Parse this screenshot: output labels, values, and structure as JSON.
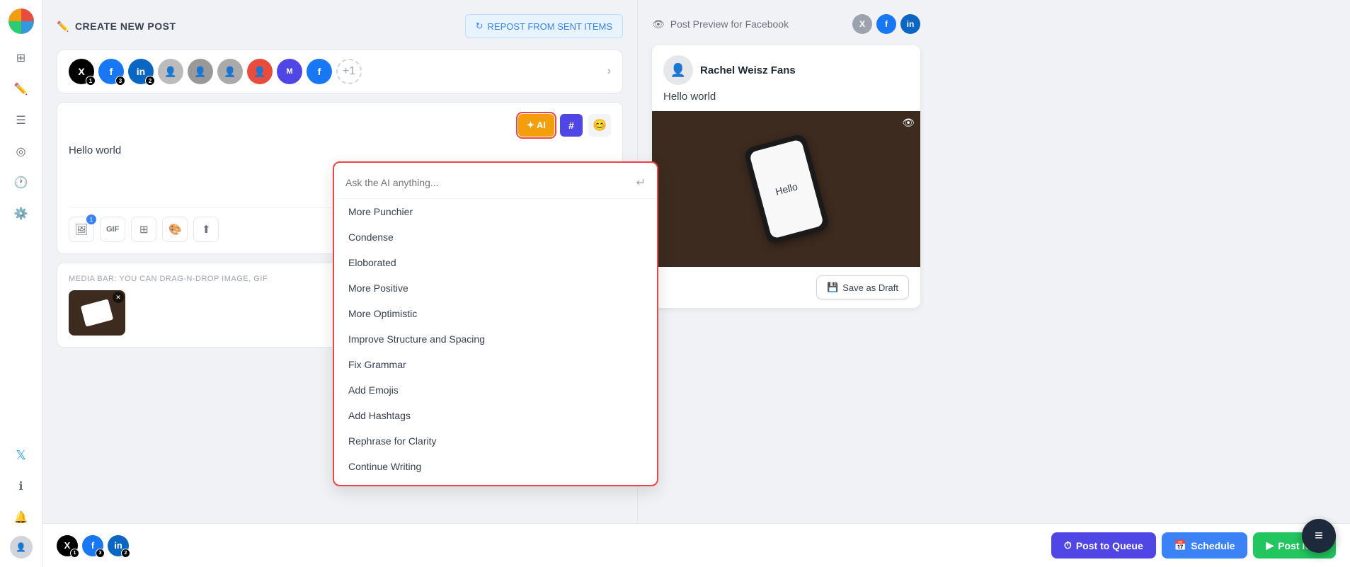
{
  "app": {
    "logo_alt": "App Logo"
  },
  "sidebar": {
    "icons": [
      {
        "name": "grid-icon",
        "symbol": "⊞",
        "active": false
      },
      {
        "name": "edit-icon",
        "symbol": "✏️",
        "active": false
      },
      {
        "name": "list-icon",
        "symbol": "☰",
        "active": false
      },
      {
        "name": "rss-icon",
        "symbol": "◎",
        "active": false
      },
      {
        "name": "clock-icon",
        "symbol": "🕐",
        "active": false
      },
      {
        "name": "settings-icon",
        "symbol": "⚙️",
        "active": false
      }
    ],
    "twitter_icon": "𝕏",
    "info_icon": "ℹ",
    "bell_icon": "🔔"
  },
  "header": {
    "create_label": "CREATE NEW POST",
    "repost_label": "REPOST FROM SENT ITEMS"
  },
  "accounts": [
    {
      "type": "x",
      "bg": "#000000",
      "label": "X",
      "badge": "1"
    },
    {
      "type": "facebook",
      "bg": "#1877f2",
      "label": "f",
      "badge": "3"
    },
    {
      "type": "linkedin",
      "bg": "#0a66c2",
      "label": "in",
      "badge": "2"
    },
    {
      "type": "avatar1",
      "bg": "#d1d5db",
      "label": "👤",
      "badge": null
    },
    {
      "type": "avatar2",
      "bg": "#d1d5db",
      "label": "👤",
      "badge": null
    },
    {
      "type": "avatar3",
      "bg": "#d1d5db",
      "label": "👤",
      "badge": null
    },
    {
      "type": "avatar4",
      "bg": "#e74c3c",
      "label": "👤",
      "badge": null
    },
    {
      "type": "avatar5",
      "bg": "#4f46e5",
      "label": "M",
      "badge": null
    },
    {
      "type": "avatar6",
      "bg": "#1877f2",
      "label": "f",
      "badge": null
    },
    {
      "type": "plus",
      "label": "+1",
      "badge": null
    }
  ],
  "editor": {
    "post_text": "Hello world",
    "ai_button_label": "✦ AI",
    "hash_label": "#",
    "emoji_label": "😊"
  },
  "ai_dropdown": {
    "placeholder": "Ask the AI anything...",
    "items": [
      {
        "label": "More Punchier"
      },
      {
        "label": "Condense"
      },
      {
        "label": "Eloborated"
      },
      {
        "label": "More Positive"
      },
      {
        "label": "More Optimistic"
      },
      {
        "label": "Improve Structure and Spacing"
      },
      {
        "label": "Fix Grammar"
      },
      {
        "label": "Add Emojis"
      },
      {
        "label": "Add Hashtags"
      },
      {
        "label": "Rephrase for Clarity"
      },
      {
        "label": "Continue Writing"
      }
    ]
  },
  "media_bar": {
    "label": "MEDIA BAR: YOU CAN DRAG-N-DROP IMAGE, GIF"
  },
  "action_buttons": {
    "queue_label": "Post to Queue",
    "schedule_label": "Schedule",
    "post_label": "Post Now"
  },
  "bottom_accounts": [
    {
      "type": "x",
      "bg": "#000000",
      "label": "X",
      "badge": "1"
    },
    {
      "type": "facebook",
      "bg": "#1877f2",
      "label": "f",
      "badge": "3"
    },
    {
      "type": "linkedin",
      "bg": "#0a66c2",
      "label": "in",
      "badge": "2"
    }
  ],
  "preview": {
    "title": "Post Preview for Facebook",
    "eye_icon": "👁",
    "profile_name": "Rachel Weisz Fans",
    "post_text": "Hello world",
    "save_draft_label": "Save as Draft",
    "phone_text": "Hello"
  },
  "preview_social_icons": [
    {
      "type": "x",
      "bg": "#9ca3af",
      "label": "X"
    },
    {
      "type": "fb",
      "bg": "#1877f2",
      "label": "f"
    },
    {
      "type": "li",
      "bg": "#0a66c2",
      "label": "in"
    }
  ],
  "floating_btn": {
    "label": "≡"
  }
}
